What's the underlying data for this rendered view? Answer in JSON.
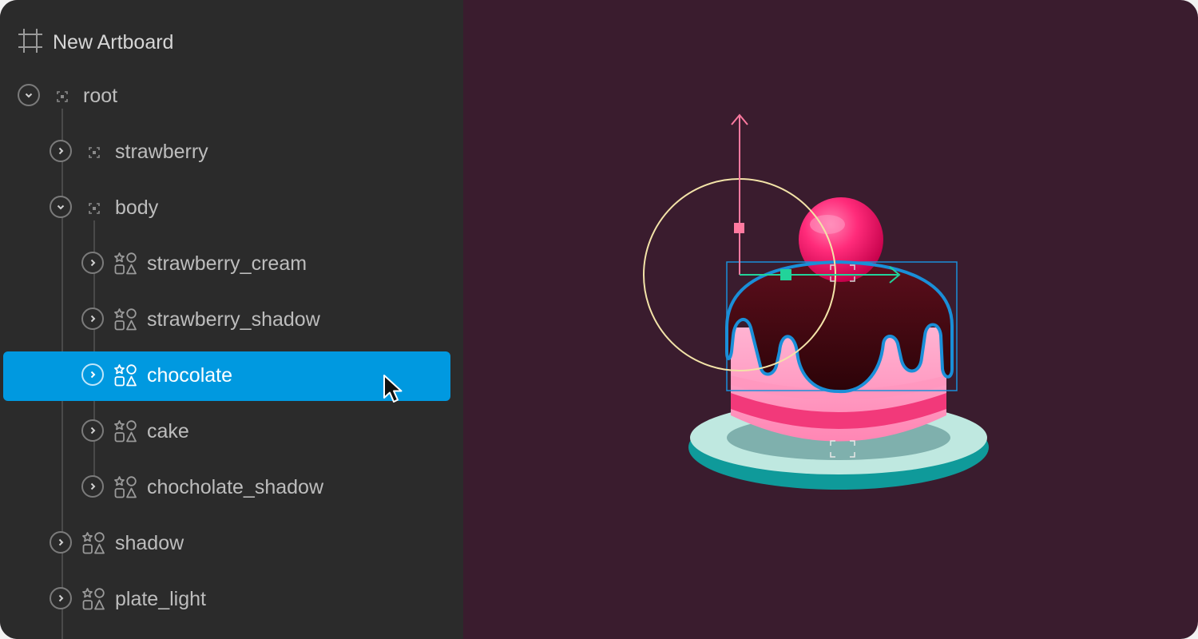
{
  "artboard": {
    "title": "New Artboard",
    "icon": "artboard-icon"
  },
  "layers": [
    {
      "id": "root",
      "label": "root",
      "depth": 0,
      "expanded": true,
      "type": "group"
    },
    {
      "id": "strawberry",
      "label": "strawberry",
      "depth": 1,
      "expanded": false,
      "type": "group"
    },
    {
      "id": "body",
      "label": "body",
      "depth": 1,
      "expanded": true,
      "type": "group"
    },
    {
      "id": "strawberry-cream",
      "label": "strawberry_cream",
      "depth": 2,
      "expanded": false,
      "type": "shape"
    },
    {
      "id": "strawberry-shadow",
      "label": "strawberry_shadow",
      "depth": 2,
      "expanded": false,
      "type": "shape"
    },
    {
      "id": "chocolate",
      "label": "chocolate",
      "depth": 2,
      "expanded": false,
      "type": "shape",
      "selected": true
    },
    {
      "id": "cake",
      "label": "cake",
      "depth": 2,
      "expanded": false,
      "type": "shape"
    },
    {
      "id": "chocholate-shadow",
      "label": "chocholate_shadow",
      "depth": 2,
      "expanded": false,
      "type": "shape"
    },
    {
      "id": "shadow",
      "label": "shadow",
      "depth": 1,
      "expanded": false,
      "type": "shape"
    },
    {
      "id": "plate-light",
      "label": "plate_light",
      "depth": 1,
      "expanded": false,
      "type": "shape"
    }
  ],
  "colors": {
    "panel": "#2b2b2b",
    "canvas": "#3a1c2e",
    "selection": "#0099e0",
    "selection_box": "#1a8fd8",
    "y_axis": "#ff7aa0",
    "x_axis": "#22d39a",
    "rotation_ring": "#f3e3a8"
  }
}
